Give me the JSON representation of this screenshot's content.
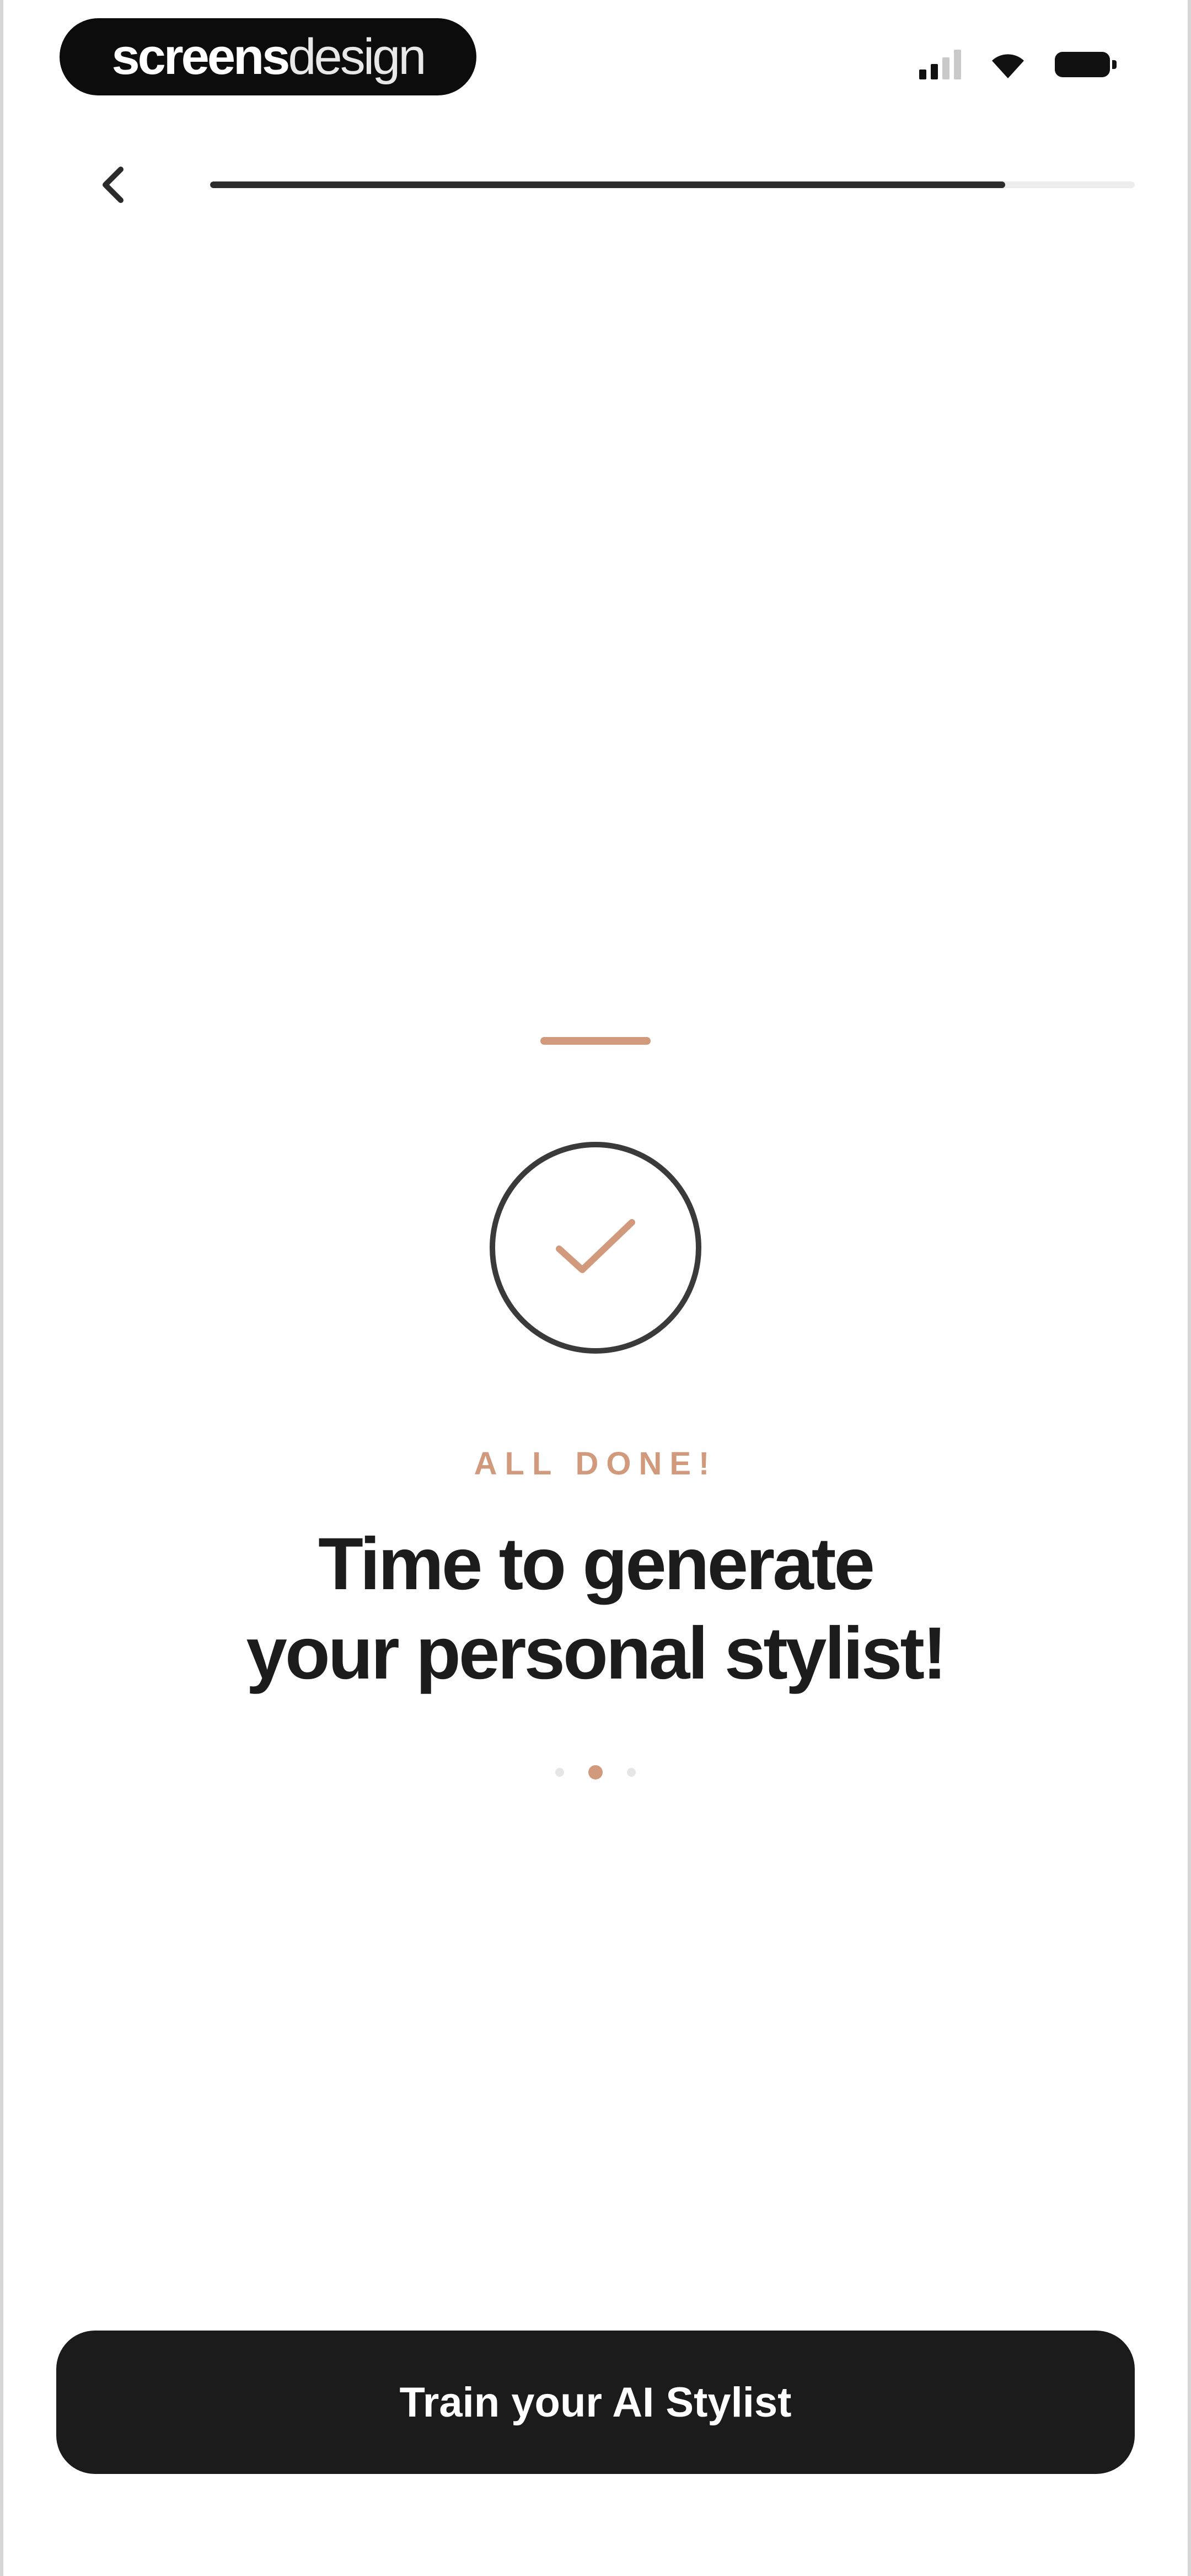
{
  "status_bar": {
    "brand_bold": "screens",
    "brand_light": "design",
    "icons": [
      "cellular-signal-icon",
      "wifi-icon",
      "battery-icon"
    ]
  },
  "nav": {
    "back_icon": "chevron-left-icon",
    "progress": 0.86
  },
  "content": {
    "eyebrow": "ALL DONE!",
    "headline_line1": "Time to generate",
    "headline_line2": "your personal stylist!",
    "check_icon": "checkmark-icon",
    "page_dots": {
      "count": 3,
      "active_index": 1
    }
  },
  "cta": {
    "label": "Train your AI Stylist"
  },
  "colors": {
    "accent": "#d29a7c",
    "text_primary": "#1c1c1c",
    "button_bg": "#1b1b1b",
    "progress_fill": "#2b2b2b",
    "progress_track": "#ededed"
  }
}
